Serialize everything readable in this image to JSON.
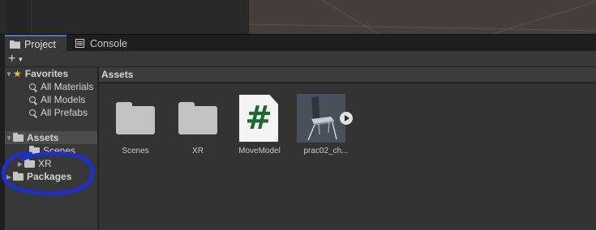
{
  "tabs": {
    "project": "Project",
    "console": "Console"
  },
  "toolbar": {
    "create_icon": "plus-icon"
  },
  "tree": {
    "favorites": {
      "label": "Favorites",
      "items": [
        "All Materials",
        "All Models",
        "All Prefabs"
      ]
    },
    "assets": {
      "label": "Assets",
      "children": [
        "Scenes",
        "XR"
      ]
    },
    "packages": {
      "label": "Packages"
    }
  },
  "main": {
    "breadcrumb": "Assets",
    "items": [
      {
        "name": "Scenes",
        "kind": "folder"
      },
      {
        "name": "XR",
        "kind": "folder"
      },
      {
        "name": "MoveModel",
        "kind": "script",
        "glyph": "#"
      },
      {
        "name": "prac02_ch...",
        "kind": "prefab"
      }
    ]
  },
  "colors": {
    "selected_tab_accent": "#4a78c4",
    "annotation_ink": "#1a2fd8",
    "script_glyph": "#1d6b2c",
    "favorites_star": "#f0c030"
  }
}
